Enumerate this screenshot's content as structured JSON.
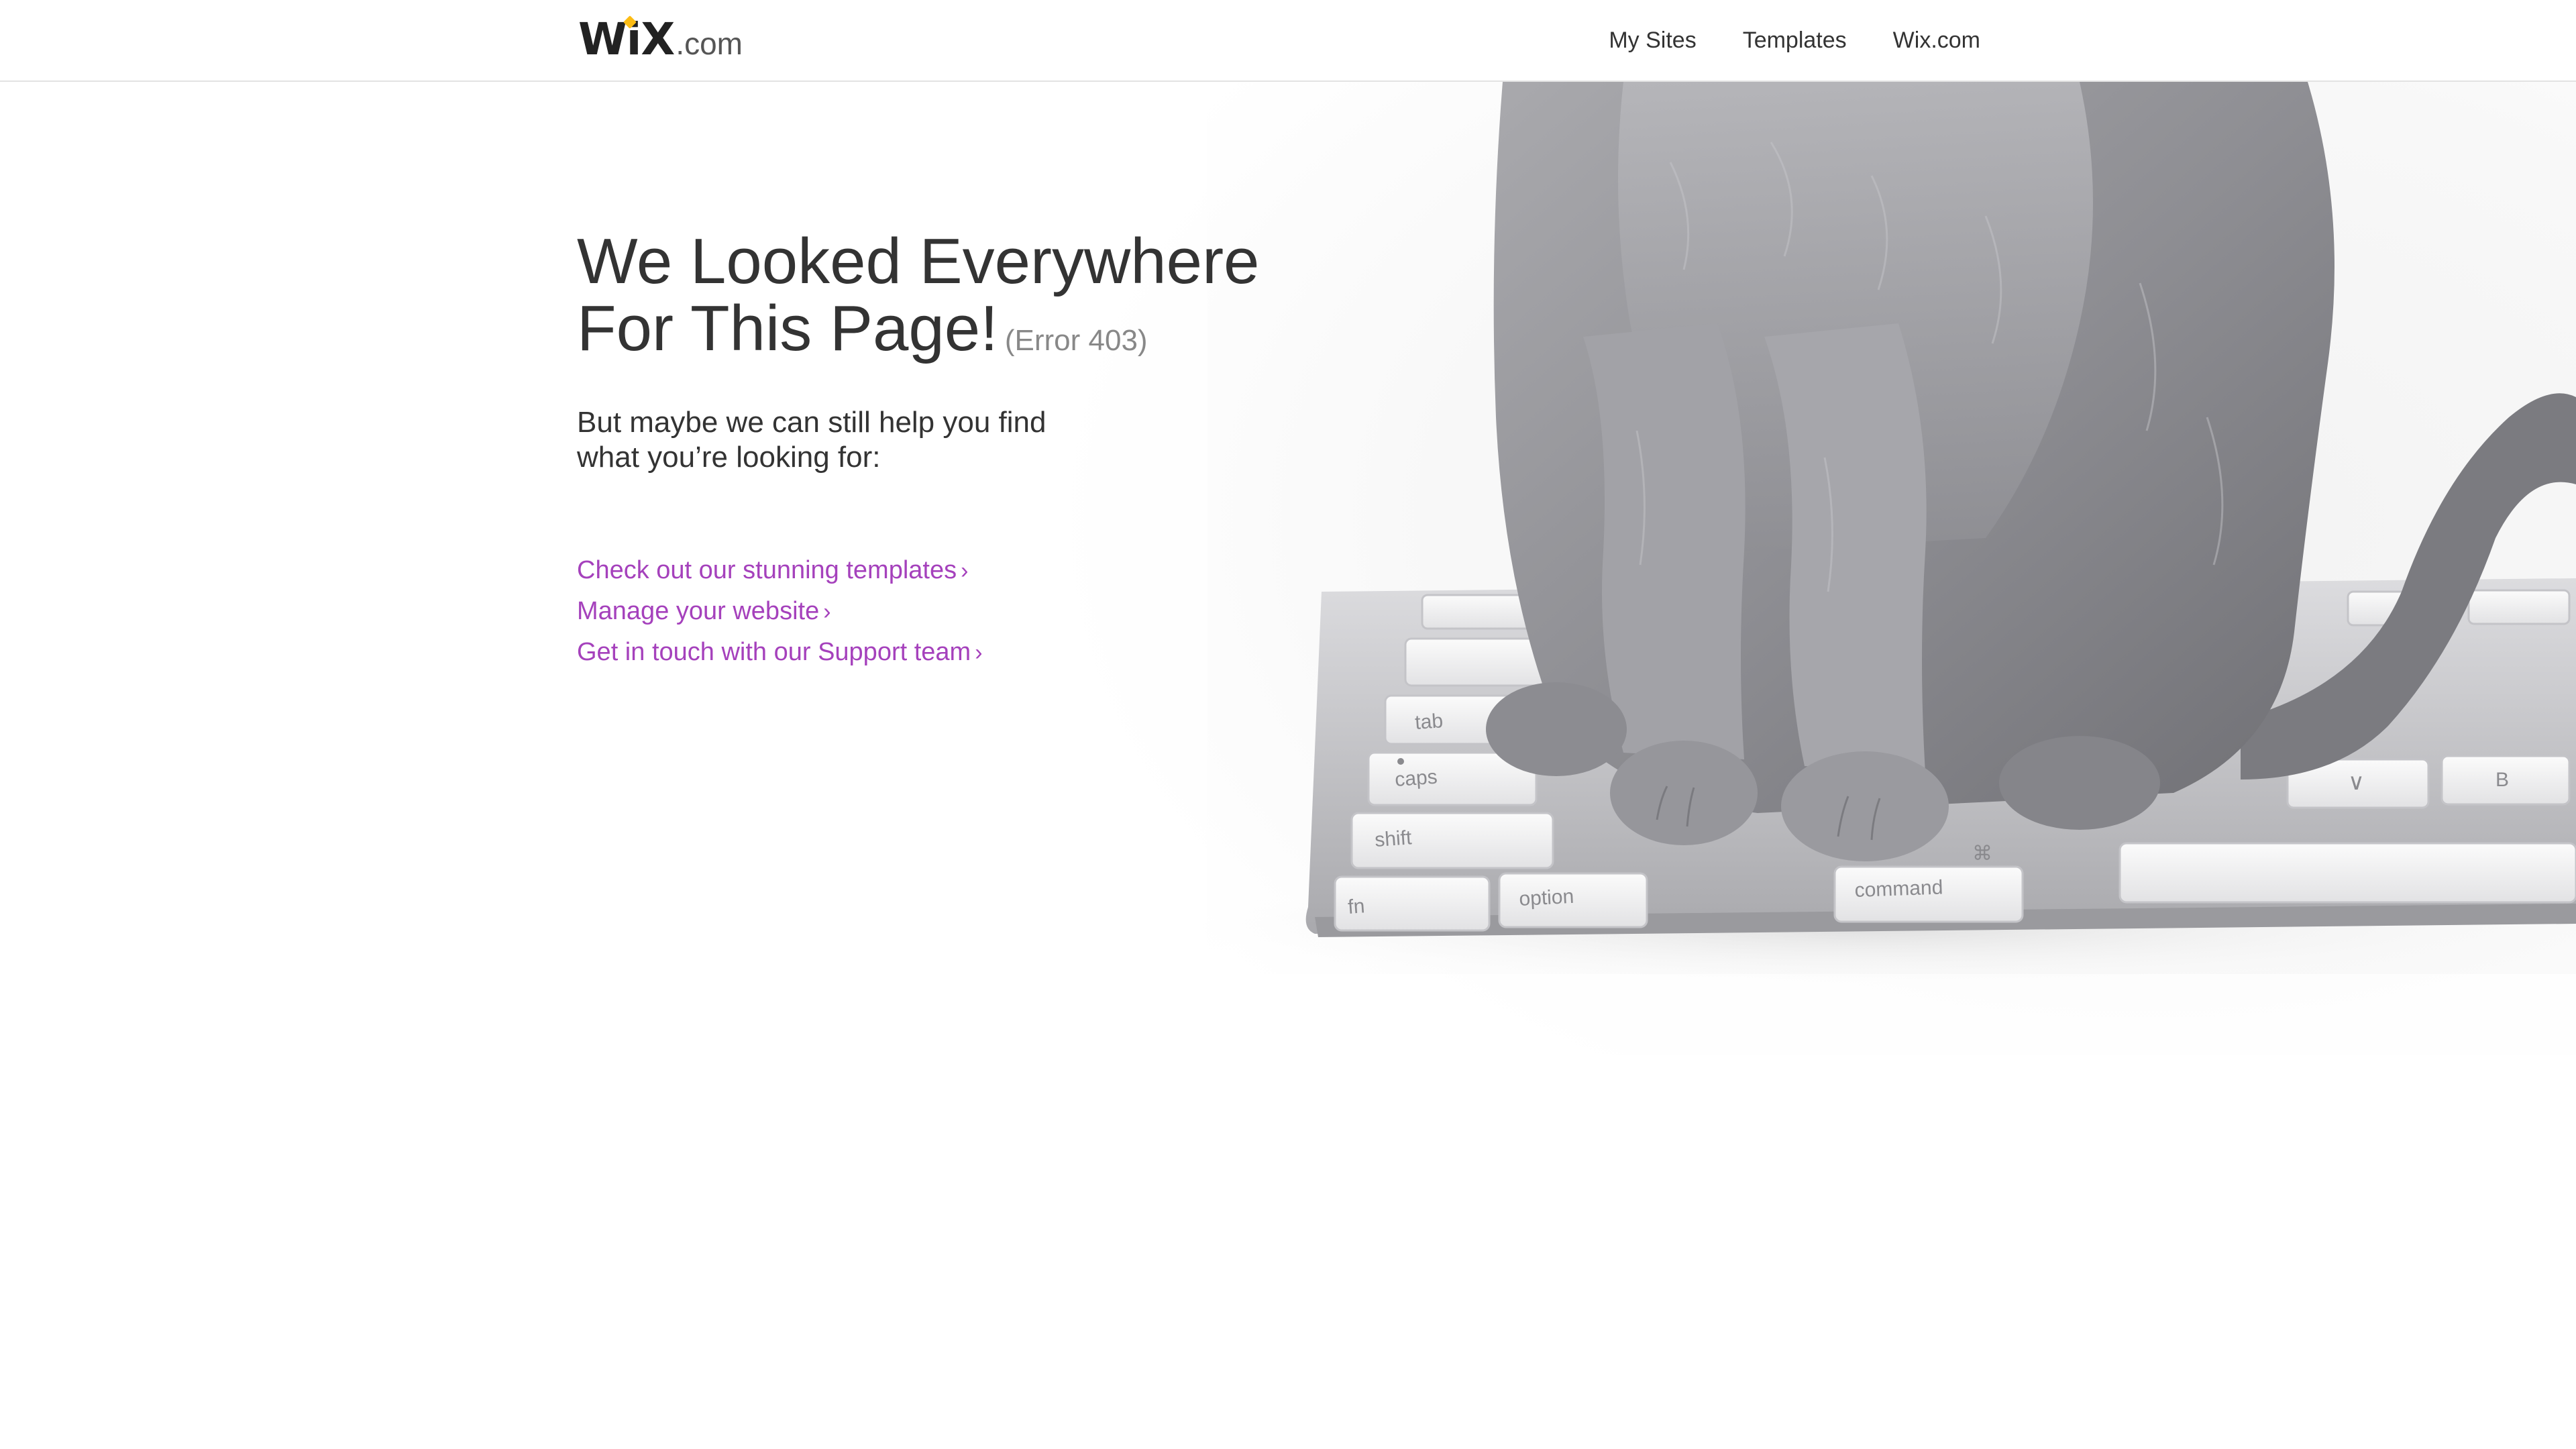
{
  "header": {
    "logo_main": "WiX",
    "logo_suffix": ".com",
    "nav": [
      {
        "label": "My Sites"
      },
      {
        "label": "Templates"
      },
      {
        "label": "Wix.com"
      }
    ]
  },
  "main": {
    "headline_line1": "We Looked Everywhere",
    "headline_line2": "For This Page!",
    "error_code": "(Error 403)",
    "subtext_line1": "But maybe we can still help you find",
    "subtext_line2": "what you’re looking for:",
    "links": [
      {
        "label": "Check out our stunning templates",
        "icon": "chevron-right-icon"
      },
      {
        "label": "Manage your website",
        "icon": "chevron-right-icon"
      },
      {
        "label": "Get in touch with our Support team",
        "icon": "chevron-right-icon"
      }
    ]
  },
  "colors": {
    "link": "#a541bc",
    "text": "#333333",
    "muted": "#888888",
    "logo_accent": "#fcbc14"
  },
  "hero_image": {
    "subject": "cat-on-keyboard-illustration"
  }
}
